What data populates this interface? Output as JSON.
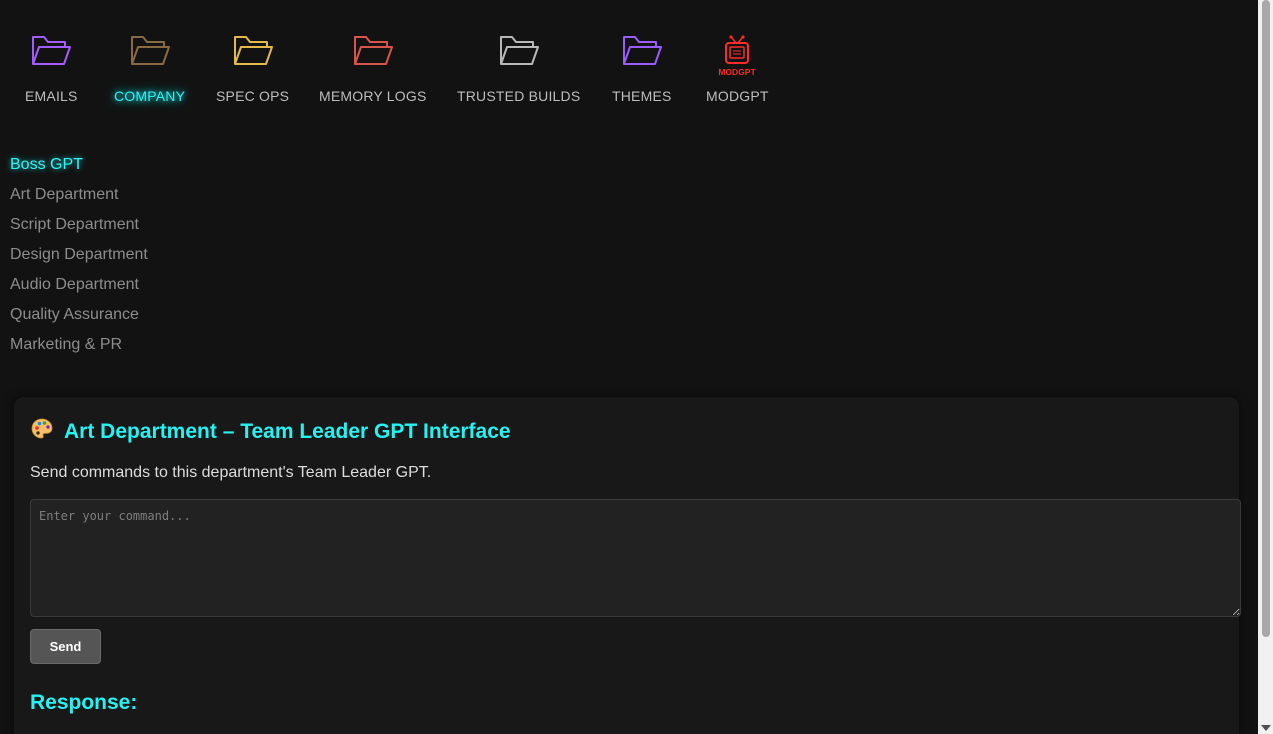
{
  "nav": {
    "items": [
      {
        "label": "EMAILS",
        "icon": "folder-icon",
        "color": "#a55cff",
        "active": false
      },
      {
        "label": "COMPANY",
        "icon": "folder-icon",
        "color": "#8a6a40",
        "active": true
      },
      {
        "label": "SPEC OPS",
        "icon": "folder-icon",
        "color": "#e3b94a",
        "active": false
      },
      {
        "label": "MEMORY LOGS",
        "icon": "folder-icon",
        "color": "#d9544a",
        "active": false
      },
      {
        "label": "TRUSTED BUILDS",
        "icon": "folder-icon",
        "color": "#b8b8b8",
        "active": false
      },
      {
        "label": "THEMES",
        "icon": "folder-icon",
        "color": "#9b5cff",
        "active": false
      },
      {
        "label": "MODGPT",
        "icon": "modgpt-tv-icon",
        "icon_text": "MODGPT",
        "color": "#ff2a2a",
        "active": false
      }
    ]
  },
  "departments": {
    "items": [
      {
        "label": "Boss GPT",
        "active": true
      },
      {
        "label": "Art Department",
        "active": false
      },
      {
        "label": "Script Department",
        "active": false
      },
      {
        "label": "Design Department",
        "active": false
      },
      {
        "label": "Audio Department",
        "active": false
      },
      {
        "label": "Quality Assurance",
        "active": false
      },
      {
        "label": "Marketing & PR",
        "active": false
      }
    ]
  },
  "panel": {
    "icon": "palette-icon",
    "title": "Art Department – Team Leader GPT Interface",
    "description": "Send commands to this department's Team Leader GPT.",
    "input_placeholder": "Enter your command...",
    "input_value": "",
    "send_label": "Send",
    "response_label": "Response:"
  },
  "colors": {
    "background": "#121212",
    "accent": "#27f2f2",
    "panel": "#181818"
  }
}
